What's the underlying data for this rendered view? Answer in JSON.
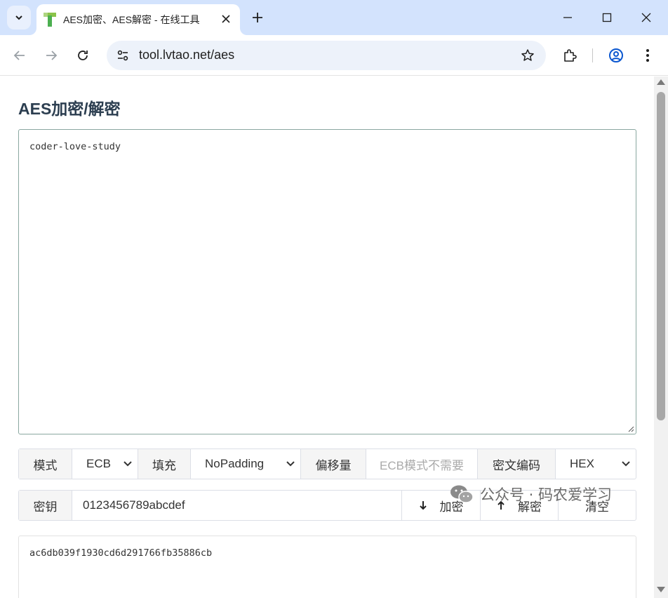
{
  "browser": {
    "tab_title": "AES加密、AES解密 - 在线工具",
    "url": "tool.lvtao.net/aes"
  },
  "page": {
    "title": "AES加密/解密",
    "input_text": "coder-love-study",
    "options": {
      "mode_label": "模式",
      "mode_value": "ECB",
      "padding_label": "填充",
      "padding_value": "NoPadding",
      "offset_label": "偏移量",
      "offset_placeholder": "ECB模式不需要",
      "encoding_label": "密文编码",
      "encoding_value": "HEX"
    },
    "key": {
      "label": "密钥",
      "value": "0123456789abcdef",
      "encrypt_label": "加密",
      "decrypt_label": "解密",
      "clear_label": "清空"
    },
    "output_text": "ac6db039f1930cd6d291766fb35886cb"
  },
  "watermark": {
    "text": "公众号 · 码农爱学习"
  },
  "colors": {
    "tabstrip": "#d3e3fd",
    "title": "#2c3e50",
    "addon_bg": "#f5f5f5"
  }
}
